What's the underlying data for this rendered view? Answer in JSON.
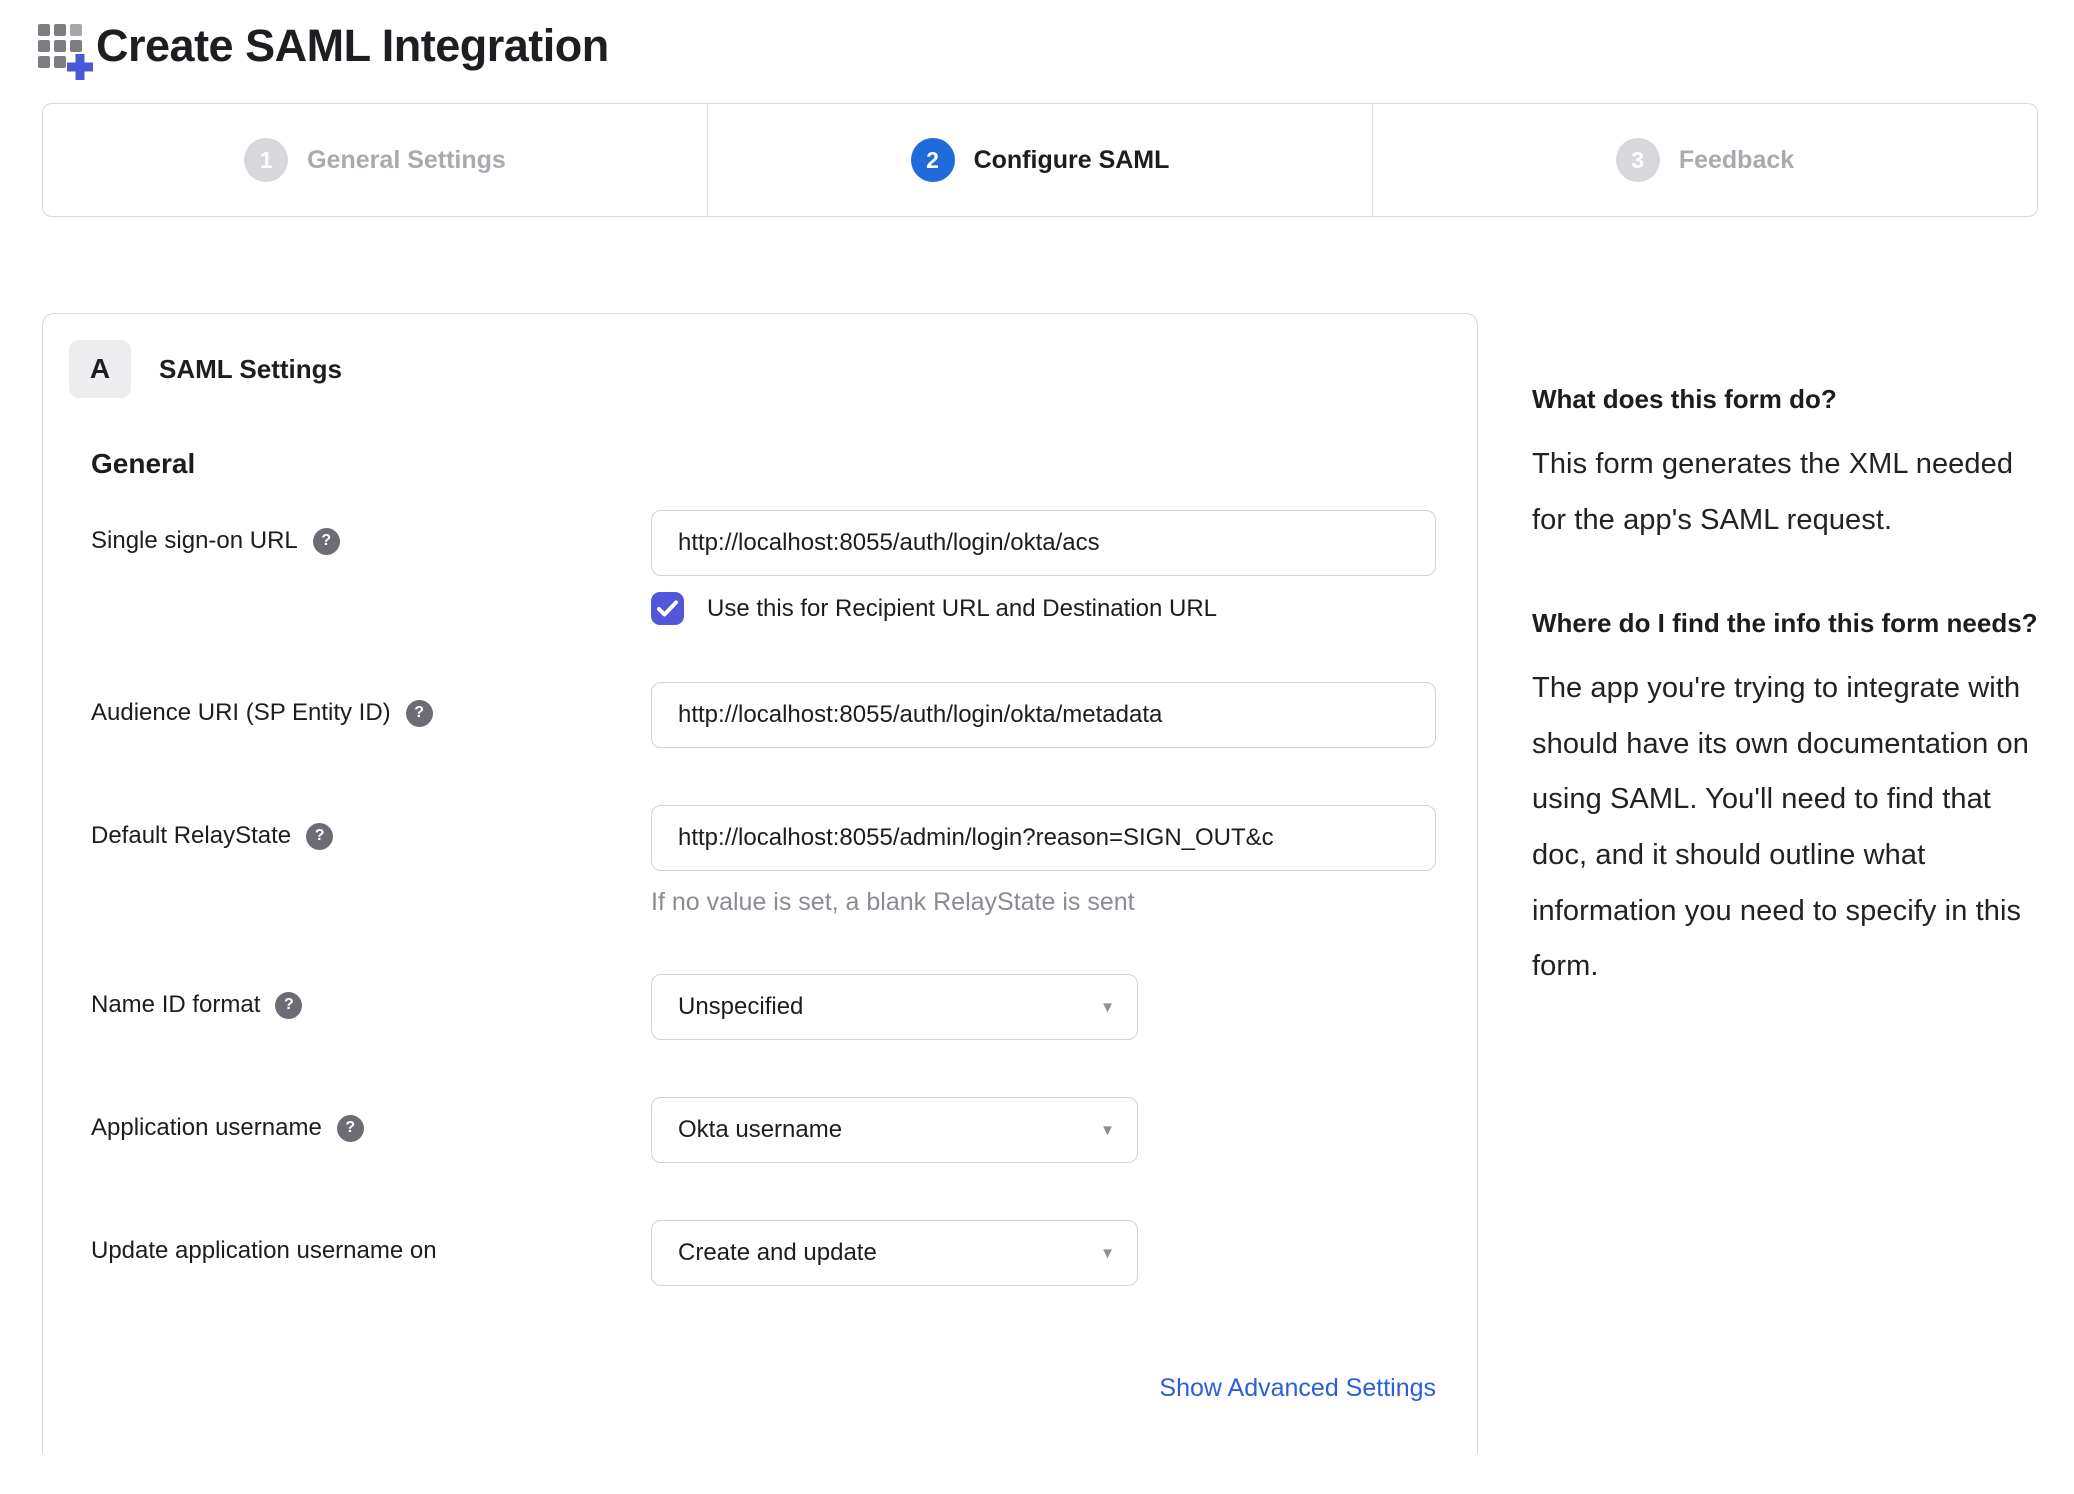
{
  "header": {
    "title": "Create SAML Integration",
    "icon": "grid-plus-icon"
  },
  "steps": {
    "items": [
      {
        "number": "1",
        "label": "General Settings",
        "state": "inactive"
      },
      {
        "number": "2",
        "label": "Configure SAML",
        "state": "active"
      },
      {
        "number": "3",
        "label": "Feedback",
        "state": "inactive"
      }
    ]
  },
  "panel": {
    "badge": "A",
    "title": "SAML Settings",
    "section": "General",
    "help_glyph": "?",
    "caret_glyph": "▼",
    "rows": {
      "sso": {
        "label": "Single sign-on URL",
        "value": "http://localhost:8055/auth/login/okta/acs",
        "checkbox_checked": true,
        "checkbox_label": "Use this for Recipient URL and Destination URL"
      },
      "audience": {
        "label": "Audience URI (SP Entity ID)",
        "value": "http://localhost:8055/auth/login/okta/metadata"
      },
      "relay": {
        "label": "Default RelayState",
        "value": "http://localhost:8055/admin/login?reason=SIGN_OUT&c",
        "helper": "If no value is set, a blank RelayState is sent"
      },
      "nameid": {
        "label": "Name ID format",
        "value": "Unspecified"
      },
      "appuser": {
        "label": "Application username",
        "value": "Okta username"
      },
      "updateuser": {
        "label": "Update application username on",
        "value": "Create and update"
      }
    },
    "advanced_link": "Show Advanced Settings"
  },
  "sidebar": {
    "q1": "What does this form do?",
    "a1": "This form generates the XML needed for the app's SAML request.",
    "q2": "Where do I find the info this form needs?",
    "a2": "The app you're trying to integrate with should have its own documentation on using SAML. You'll need to find that doc, and it should outline what information you need to specify in this form."
  },
  "colors": {
    "step_active_blue": "#1f6bd9",
    "checkbox_blue": "#5157d8",
    "link_blue": "#2b5fd9",
    "icon_plus_blue": "#4b57d8",
    "icon_square_gray": "#7d7d82"
  }
}
